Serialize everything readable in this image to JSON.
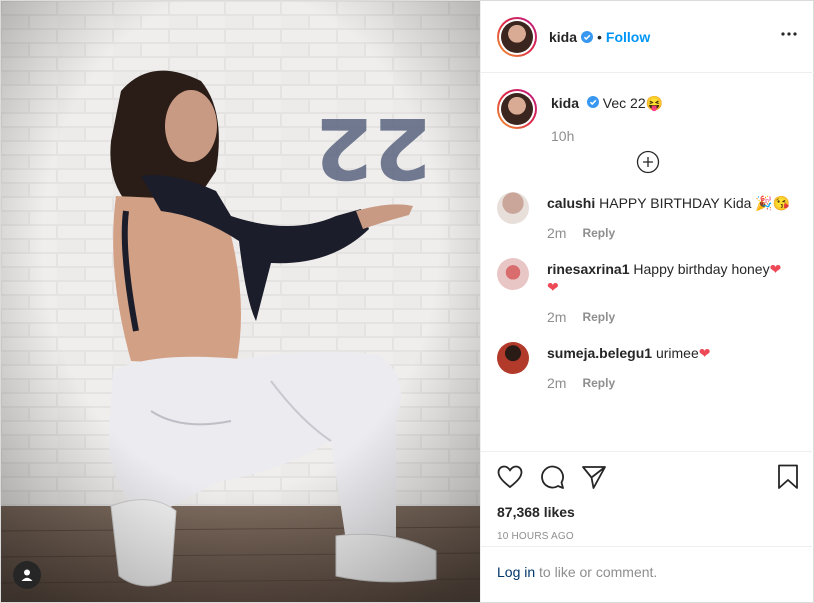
{
  "post": {
    "username": "kida",
    "follow_label": "Follow",
    "dot": "•",
    "caption": {
      "username": "kida",
      "text": "Vec 22",
      "emoji": "😝",
      "age": "10h"
    },
    "comments": [
      {
        "username": "calushi",
        "text": "HAPPY BIRTHDAY Kida 🎉😘",
        "age": "2m",
        "reply_label": "Reply",
        "avatar_color": "#c9a59a"
      },
      {
        "username": "rinesaxrina1",
        "text": "Happy birthday honey",
        "age": "2m",
        "reply_label": "Reply",
        "avatar_color": "#d96d6d"
      },
      {
        "username": "sumeja.belegu1",
        "text": "urimee",
        "age": "2m",
        "reply_label": "Reply",
        "avatar_color": "#b23a2a"
      }
    ],
    "likes": "87,368 likes",
    "time_ago": "10 HOURS AGO",
    "login_link": "Log in",
    "login_rest": "to like or comment."
  },
  "media": {
    "overlay_text": "22",
    "icons": {
      "user_tag": "user-tag-icon"
    }
  },
  "icons": {
    "verified": "verified-badge-icon",
    "more": "more-options-icon",
    "load_more": "load-more-comments-icon",
    "like": "heart-icon",
    "comment": "comment-icon",
    "share": "share-icon",
    "save": "bookmark-icon"
  },
  "colors": {
    "accent": "#0095f6",
    "verified": "#3897f0",
    "heart": "#ed4956",
    "muted": "#8e8e8e"
  }
}
